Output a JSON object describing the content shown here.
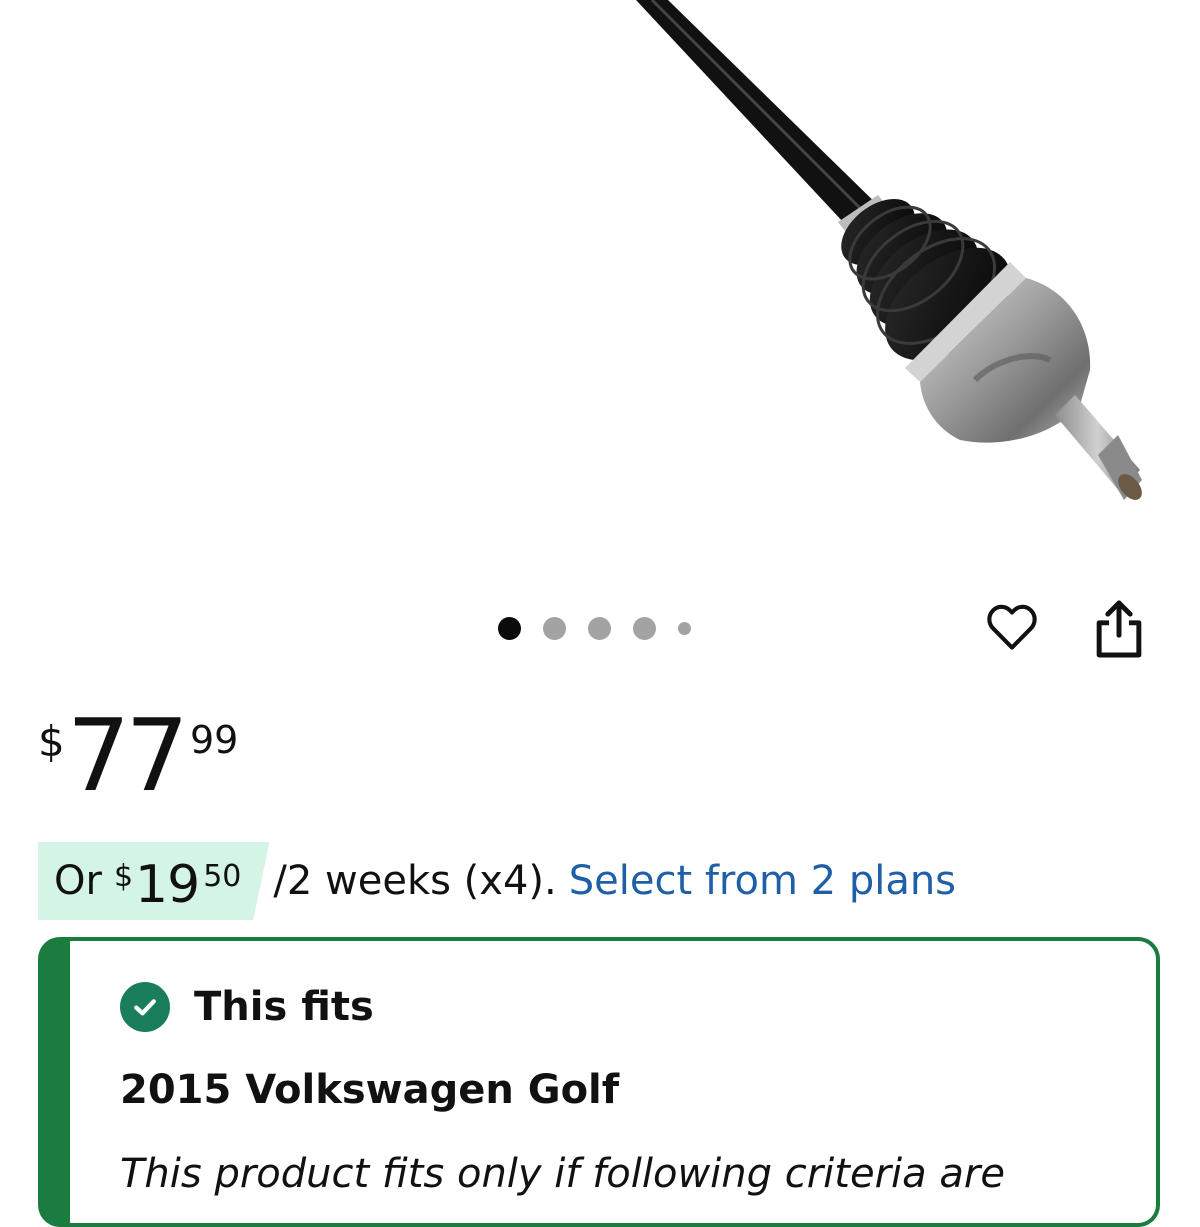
{
  "carousel": {
    "dots": [
      {
        "state": "active",
        "size": "large"
      },
      {
        "state": "inactive",
        "size": "large"
      },
      {
        "state": "inactive",
        "size": "large"
      },
      {
        "state": "inactive",
        "size": "large"
      },
      {
        "state": "inactive",
        "size": "small"
      }
    ]
  },
  "actions": {
    "favorite_icon": "heart-icon",
    "share_icon": "share-icon"
  },
  "price": {
    "currency": "$",
    "whole": "77",
    "cents": "99"
  },
  "installment": {
    "prefix": "Or",
    "currency": "$",
    "whole": "19",
    "cents": "50",
    "period": "/2 weeks (x4).",
    "link_label": "Select from 2 plans"
  },
  "fitment": {
    "title": "This fits",
    "vehicle": "2015 Volkswagen Golf",
    "note": "This product fits only if following criteria are"
  },
  "colors": {
    "link": "#1f5fa8",
    "fit_green": "#1a7d3f",
    "badge_mint": "#d4f4e6",
    "dot_active": "#0b0b0b",
    "dot_inactive": "#a3a3a3"
  }
}
